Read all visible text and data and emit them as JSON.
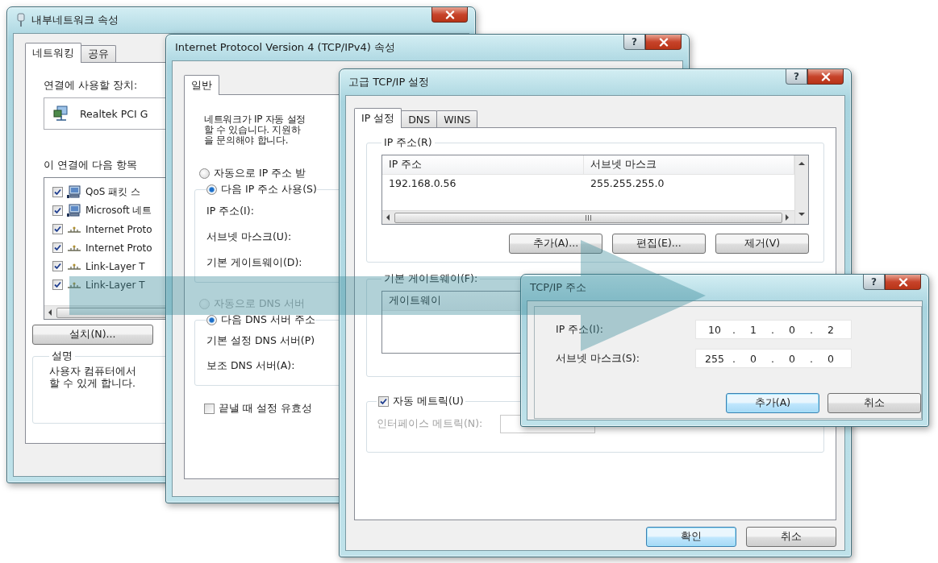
{
  "windows": [
    {
      "kind": "network_properties",
      "title": "내부네트워크 속성",
      "tabs": [
        {
          "label": "네트워킹",
          "selected": true
        },
        {
          "label": "공유",
          "selected": false
        }
      ],
      "device_label": "연결에 사용할 장치:",
      "device": "Realtek PCI G",
      "items_label": "이 연결에 다음 항목",
      "items": [
        {
          "kind": "adapter",
          "label": "QoS 패킷 스",
          "checked": true
        },
        {
          "kind": "adapter",
          "label": "Microsoft 네트",
          "checked": true
        },
        {
          "kind": "protocol",
          "label": "Internet Proto",
          "checked": true
        },
        {
          "kind": "protocol",
          "label": "Internet Proto",
          "checked": true
        },
        {
          "kind": "protocol",
          "label": "Link-Layer T",
          "checked": true
        },
        {
          "kind": "protocol",
          "label": "Link-Layer T",
          "checked": true
        }
      ],
      "install_button": "설치(N)...",
      "description_title": "설명",
      "description_lines": [
        "사용자 컴퓨터에서",
        "할 수 있게 합니다."
      ]
    },
    {
      "kind": "ipv4_properties",
      "title": "Internet Protocol Version 4 (TCP/IPv4) 속성",
      "help": "?",
      "tabs": [
        {
          "label": "일반",
          "selected": true
        }
      ],
      "intro_lines": [
        "네트워크가 IP 자동 설정",
        "할 수 있습니다. 지원하",
        "을 문의해야 합니다."
      ],
      "ip_options": [
        {
          "label": "자동으로 IP 주소 받",
          "selected": false,
          "disabled": false
        },
        {
          "label": "다음 IP 주소 사용(S)",
          "selected": true,
          "disabled": false
        }
      ],
      "ip_fields": [
        "IP 주소(I):",
        "서브넷 마스크(U):",
        "기본 게이트웨이(D):"
      ],
      "dns_options": [
        {
          "label": "자동으로 DNS 서버",
          "selected": false,
          "disabled": true
        },
        {
          "label": "다음 DNS 서버 주소",
          "selected": true,
          "disabled": false
        }
      ],
      "dns_fields": [
        "기본 설정 DNS 서버(P)",
        "보조 DNS 서버(A):"
      ],
      "validate": {
        "label": "끝낼 때 설정 유효성",
        "checked": false
      }
    },
    {
      "kind": "advanced_tcpip",
      "title": "고급 TCP/IP 설정",
      "help": "?",
      "tabs": [
        {
          "label": "IP 설정",
          "selected": true
        },
        {
          "label": "DNS",
          "selected": false
        },
        {
          "label": "WINS",
          "selected": false
        }
      ],
      "ip_group": {
        "title": "IP 주소(R)",
        "columns": [
          "IP 주소",
          "서브넷 마스크"
        ],
        "rows": [
          [
            "192.168.0.56",
            "255.255.255.0"
          ]
        ],
        "buttons": [
          {
            "label": "추가(A)...",
            "focused": false
          },
          {
            "label": "편집(E)...",
            "focused": false
          },
          {
            "label": "제거(V)",
            "focused": false
          }
        ]
      },
      "gateway_group": {
        "title": "기본 게이트웨이(F):",
        "columns": [
          "게이트웨이"
        ]
      },
      "auto_metric": {
        "label": "자동 메트릭(U)",
        "checked": true
      },
      "interface_metric": {
        "label": "인터페이스 메트릭(N):",
        "disabled": true
      },
      "buttons": [
        {
          "label": "확인",
          "focused": true
        },
        {
          "label": "취소",
          "focused": false
        }
      ]
    },
    {
      "kind": "tcpip_address",
      "title": "TCP/IP 주소",
      "help": "?",
      "fields": [
        {
          "label": "IP 주소(I):",
          "octets": [
            "10",
            "1",
            "0",
            "2"
          ],
          "separator": "."
        },
        {
          "label": "서브넷 마스크(S):",
          "octets": [
            "255",
            "0",
            "0",
            "0"
          ],
          "separator": "."
        }
      ],
      "buttons": [
        {
          "label": "추가(A)",
          "focused": true
        },
        {
          "label": "취소",
          "focused": false
        }
      ]
    }
  ]
}
